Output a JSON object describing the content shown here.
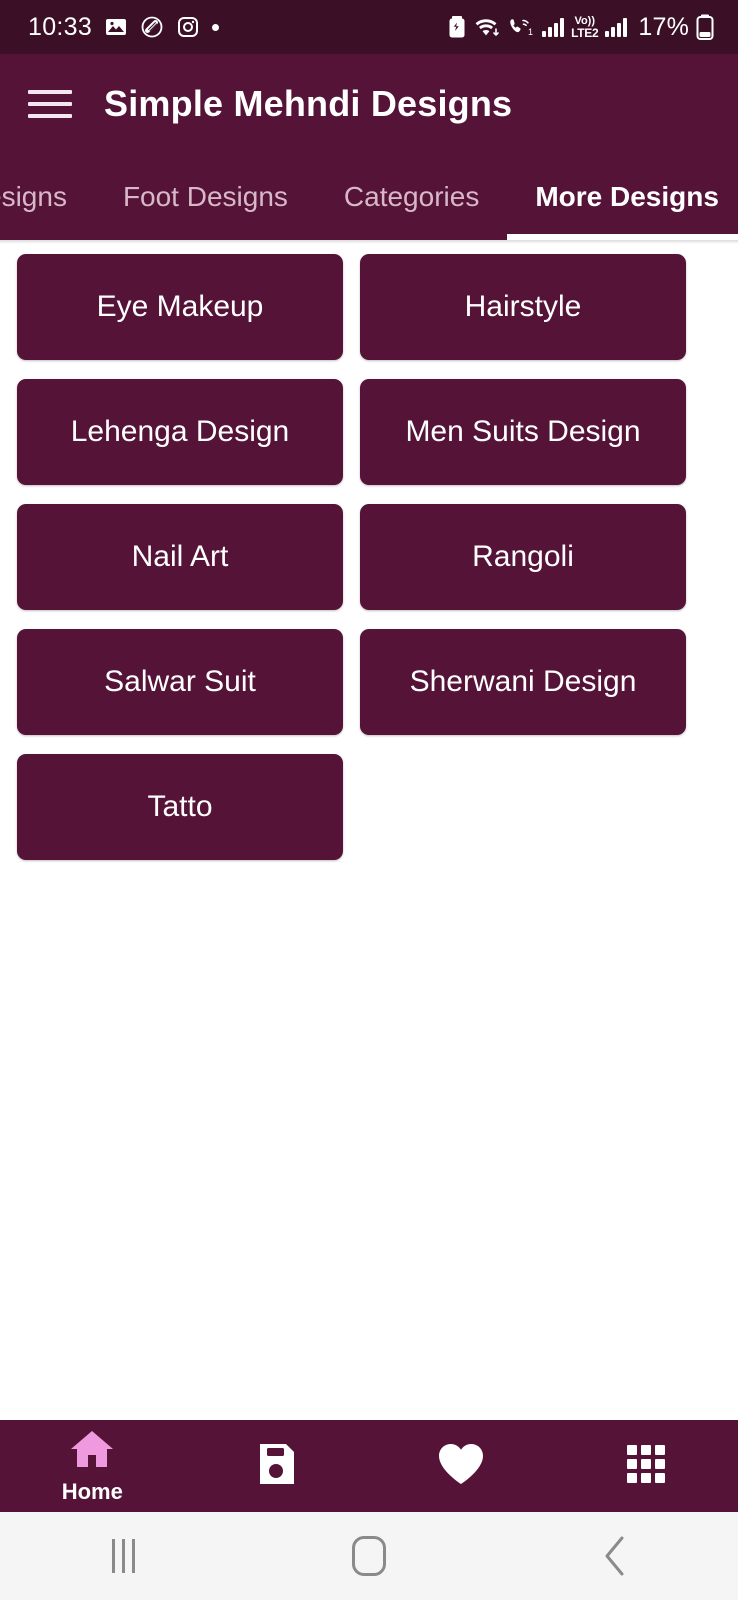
{
  "status_bar": {
    "time": "10:33",
    "battery_percent": "17%",
    "volte_label_top": "Vo))",
    "volte_label_bottom": "LTE2",
    "sim_index": "1",
    "icons": [
      "gallery-icon",
      "smart-tag-icon",
      "instagram-icon",
      "notification-dot",
      "battery-saver-icon",
      "wifi-icon",
      "volte-call-icon",
      "signal-bars-icon",
      "volte2-icon",
      "signal-bars-2-icon",
      "battery-icon"
    ]
  },
  "appbar": {
    "menu_icon": "hamburger-menu-icon",
    "title": "Simple Mehndi Designs"
  },
  "tabs": {
    "items": [
      {
        "label": "esigns",
        "active": false,
        "clipped": true
      },
      {
        "label": "Foot Designs",
        "active": false,
        "clipped": false
      },
      {
        "label": "Categories",
        "active": false,
        "clipped": false
      },
      {
        "label": "More Designs",
        "active": true,
        "clipped": false
      }
    ]
  },
  "grid": {
    "cards": [
      {
        "label": "Eye Makeup"
      },
      {
        "label": "Hairstyle"
      },
      {
        "label": "Lehenga Design"
      },
      {
        "label": "Men Suits Design"
      },
      {
        "label": "Nail Art"
      },
      {
        "label": "Rangoli"
      },
      {
        "label": "Salwar Suit"
      },
      {
        "label": "Sherwani Design"
      },
      {
        "label": "Tatto"
      }
    ]
  },
  "bottom_nav": {
    "items": [
      {
        "icon": "home-icon",
        "label": "Home",
        "active": true
      },
      {
        "icon": "save-icon",
        "label": "",
        "active": false
      },
      {
        "icon": "heart-icon",
        "label": "",
        "active": false
      },
      {
        "icon": "grid-apps-icon",
        "label": "",
        "active": false
      }
    ]
  },
  "system_nav": {
    "recents": "recents-icon",
    "home": "system-home-icon",
    "back": "back-icon"
  },
  "colors": {
    "status_bar_bg": "#3b1027",
    "primary": "#551437",
    "card_bg": "#551437",
    "accent_pink": "#ef9ade",
    "text_on_primary": "#ffffff",
    "tab_inactive": "#d8b7c9",
    "page_bg": "#ffffff",
    "system_nav_bg": "#f5f5f5"
  }
}
